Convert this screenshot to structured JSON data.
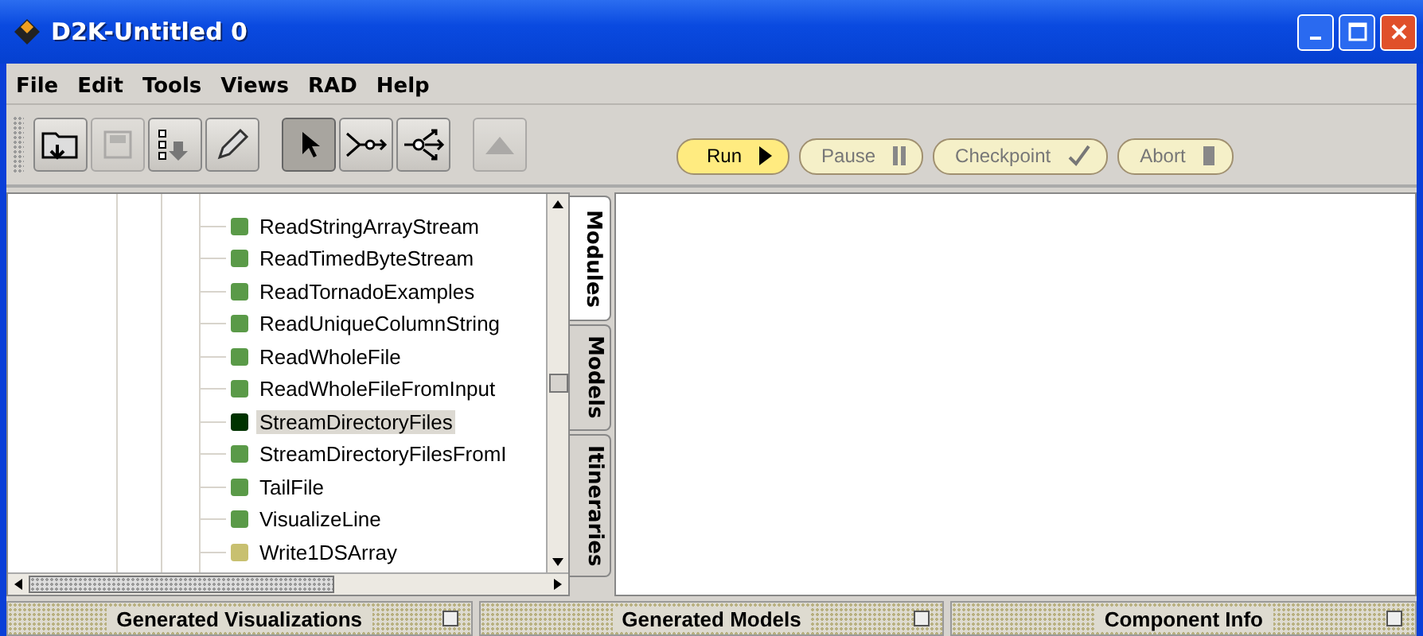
{
  "window": {
    "title": "D2K-Untitled 0"
  },
  "menu": [
    {
      "label": "File"
    },
    {
      "label": "Edit"
    },
    {
      "label": "Tools"
    },
    {
      "label": "Views"
    },
    {
      "label": "RAD"
    },
    {
      "label": "Help"
    }
  ],
  "toolbar": [
    {
      "kind": "open",
      "disabled": false,
      "selected": false
    },
    {
      "kind": "save",
      "disabled": true,
      "selected": false
    },
    {
      "kind": "list",
      "disabled": false,
      "selected": false
    },
    {
      "kind": "edit",
      "disabled": false,
      "selected": false
    },
    {
      "kind": "gap"
    },
    {
      "kind": "pointer",
      "disabled": false,
      "selected": true
    },
    {
      "kind": "connect",
      "disabled": false,
      "selected": false
    },
    {
      "kind": "fanout",
      "disabled": false,
      "selected": false
    },
    {
      "kind": "gap"
    },
    {
      "kind": "up",
      "disabled": true,
      "selected": false
    }
  ],
  "run_controls": [
    {
      "label": "Run",
      "kind": "run",
      "disabled": false
    },
    {
      "label": "Pause",
      "kind": "pause",
      "disabled": true
    },
    {
      "label": "Checkpoint",
      "kind": "checkpoint",
      "disabled": true
    },
    {
      "label": "Abort",
      "kind": "abort",
      "disabled": true
    }
  ],
  "tree": {
    "items": [
      {
        "name": "ReadStringArrayStream",
        "color": "#5a9a48",
        "selected": false
      },
      {
        "name": "ReadTimedByteStream",
        "color": "#5a9a48",
        "selected": false
      },
      {
        "name": "ReadTornadoExamples",
        "color": "#5a9a48",
        "selected": false
      },
      {
        "name": "ReadUniqueColumnString",
        "color": "#5a9a48",
        "selected": false
      },
      {
        "name": "ReadWholeFile",
        "color": "#5a9a48",
        "selected": false
      },
      {
        "name": "ReadWholeFileFromInput",
        "color": "#5a9a48",
        "selected": false
      },
      {
        "name": "StreamDirectoryFiles",
        "color": "#003300",
        "selected": true
      },
      {
        "name": "StreamDirectoryFilesFromI",
        "color": "#5a9a48",
        "selected": false
      },
      {
        "name": "TailFile",
        "color": "#5a9a48",
        "selected": false
      },
      {
        "name": "VisualizeLine",
        "color": "#5a9a48",
        "selected": false
      },
      {
        "name": "Write1DSArray",
        "color": "#c8c070",
        "selected": false
      }
    ]
  },
  "side_tabs": [
    {
      "label": "Modules",
      "selected": true
    },
    {
      "label": "Models",
      "selected": false
    },
    {
      "label": "Itineraries",
      "selected": false
    }
  ],
  "panels": [
    {
      "title": "Generated Visualizations"
    },
    {
      "title": "Generated Models"
    },
    {
      "title": "Component Info"
    }
  ]
}
